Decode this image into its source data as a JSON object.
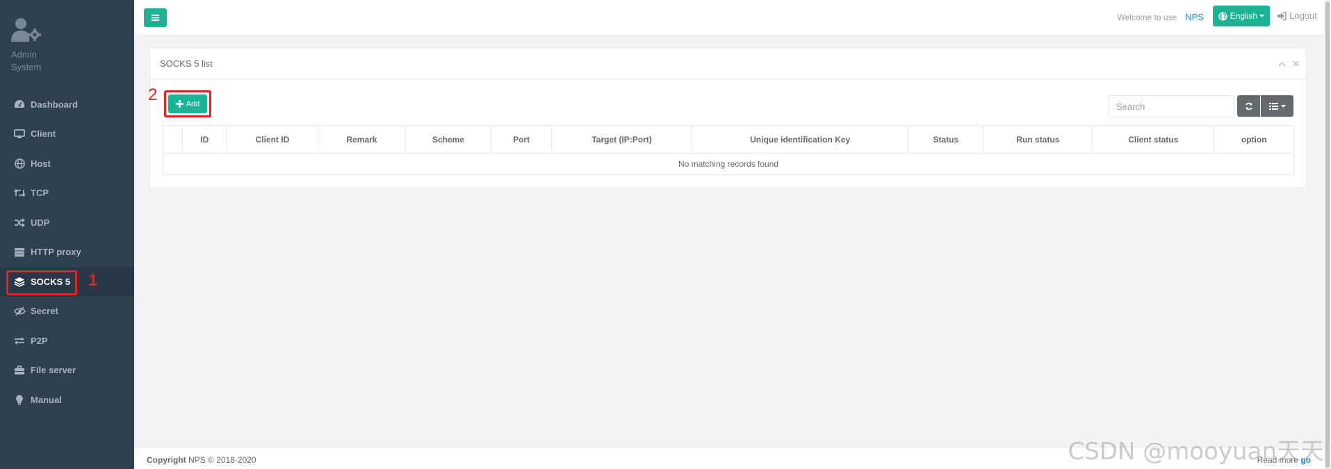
{
  "sidebar": {
    "profile": {
      "line1": "Admin",
      "line2": "System"
    },
    "items": [
      {
        "label": "Dashboard",
        "icon": "dashboard-icon"
      },
      {
        "label": "Client",
        "icon": "monitor-icon"
      },
      {
        "label": "Host",
        "icon": "globe-icon"
      },
      {
        "label": "TCP",
        "icon": "retweet-icon"
      },
      {
        "label": "UDP",
        "icon": "random-icon"
      },
      {
        "label": "HTTP proxy",
        "icon": "server-icon"
      },
      {
        "label": "SOCKS 5",
        "icon": "layers-icon",
        "active": true
      },
      {
        "label": "Secret",
        "icon": "eye-slash-icon"
      },
      {
        "label": "P2P",
        "icon": "exchange-icon"
      },
      {
        "label": "File server",
        "icon": "briefcase-icon"
      },
      {
        "label": "Manual",
        "icon": "lightbulb-icon"
      }
    ]
  },
  "annotations": {
    "step1": "1",
    "step2": "2"
  },
  "topbar": {
    "welcome": "Welcome to use",
    "brand": "NPS",
    "language": "English",
    "logout": "Logout"
  },
  "panel": {
    "title": "SOCKS 5 list",
    "add_label": "Add",
    "search_placeholder": "Search",
    "columns": [
      "",
      "ID",
      "Client ID",
      "Remark",
      "Scheme",
      "Port",
      "Target (IP:Port)",
      "Unique identification Key",
      "Status",
      "Run status",
      "Client status",
      "option"
    ],
    "empty_message": "No matching records found"
  },
  "footer": {
    "copyright_label": "Copyright",
    "copyright_text": "NPS © 2018-2020",
    "read_more": "Read more",
    "go": "go"
  },
  "watermark": "CSDN @mooyuan天天",
  "colors": {
    "sidebar": "#2f4050",
    "primary": "#1ab394",
    "highlight": "#e8221a",
    "link": "#1c84c6"
  }
}
